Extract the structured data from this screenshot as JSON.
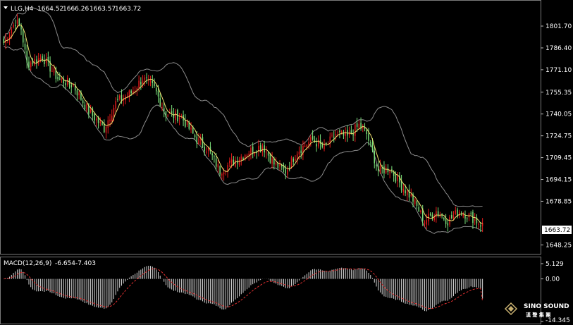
{
  "header": {
    "symbol": "LLG,H4",
    "open": "1664.52",
    "high": "1666.26",
    "low": "1663.57",
    "close": "1663.72"
  },
  "macd_header": {
    "label": "MACD(12,26,9)",
    "main": "-6.654",
    "signal": "-7.403"
  },
  "logo": {
    "name": "SINO SOUND",
    "sub": "漢 聲 集 團"
  },
  "colors": {
    "background": "#000000",
    "bull": "#e41b1b",
    "bear": "#7be07b",
    "ma": "#f0e070",
    "bands": "#8c8c8c",
    "macd_hist": "#d9d9d9",
    "macd_signal": "#e03030"
  },
  "chart_data": [
    {
      "type": "candlestick",
      "symbol": "LLG",
      "timeframe": "H4",
      "y_ticks": [
        "1801.70",
        "1786.40",
        "1771.10",
        "1755.35",
        "1740.05",
        "1724.75",
        "1709.45",
        "1694.15",
        "1678.85",
        "1648.25"
      ],
      "ylim": [
        1642,
        1820
      ],
      "current_price": "1663.72",
      "indicators": [
        "moving average",
        "bollinger bands"
      ],
      "anchors": [
        [
          0,
          1790
        ],
        [
          6,
          1805
        ],
        [
          9,
          1800
        ],
        [
          12,
          1775
        ],
        [
          20,
          1780
        ],
        [
          28,
          1765
        ],
        [
          36,
          1760
        ],
        [
          44,
          1742
        ],
        [
          52,
          1730
        ],
        [
          58,
          1748
        ],
        [
          66,
          1755
        ],
        [
          72,
          1765
        ],
        [
          78,
          1758
        ],
        [
          84,
          1740
        ],
        [
          92,
          1738
        ],
        [
          100,
          1722
        ],
        [
          106,
          1715
        ],
        [
          112,
          1700
        ],
        [
          118,
          1706
        ],
        [
          126,
          1713
        ],
        [
          134,
          1718
        ],
        [
          140,
          1705
        ],
        [
          146,
          1700
        ],
        [
          152,
          1714
        ],
        [
          160,
          1722
        ],
        [
          166,
          1716
        ],
        [
          172,
          1726
        ],
        [
          178,
          1724
        ],
        [
          184,
          1732
        ],
        [
          188,
          1726
        ],
        [
          194,
          1700
        ],
        [
          200,
          1702
        ],
        [
          206,
          1690
        ],
        [
          212,
          1680
        ],
        [
          218,
          1665
        ],
        [
          224,
          1672
        ],
        [
          230,
          1665
        ],
        [
          236,
          1672
        ],
        [
          242,
          1668
        ],
        [
          248,
          1662
        ]
      ]
    },
    {
      "type": "macd",
      "params": "12,26,9",
      "y_ticks": [
        "5.129",
        "0.00",
        "-14.345"
      ],
      "ylim": [
        -14.345,
        5.129
      ],
      "main_value": -6.654,
      "signal_value": -7.403
    }
  ]
}
